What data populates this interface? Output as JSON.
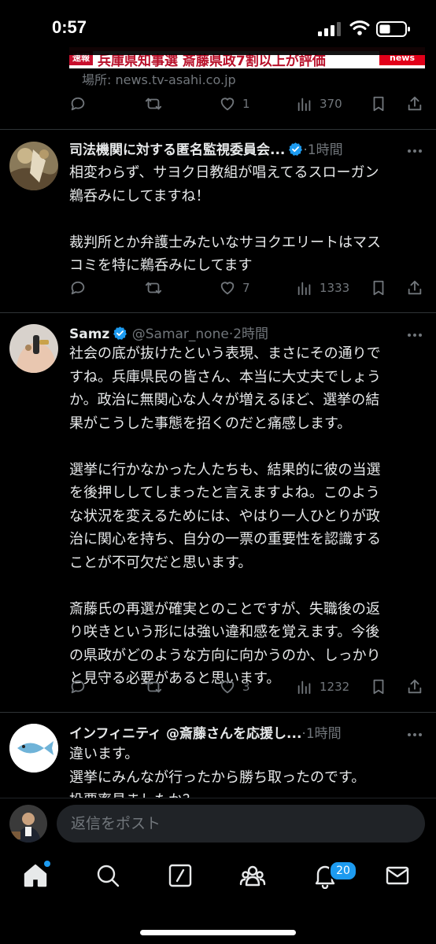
{
  "status": {
    "time": "0:57"
  },
  "quoted_card": {
    "banner_tag": "速報",
    "banner_text": "兵庫県知事選 斎藤県政7割以上が評価",
    "banner_logo": "news",
    "source": "場所: news.tv-asahi.co.jp"
  },
  "tweets": [
    {
      "actions": {
        "replies": "",
        "retweets": "",
        "likes": "1",
        "views": "370"
      }
    },
    {
      "name": "司法機関に対する匿名監視委員会...",
      "handle": "",
      "time": "·1時間",
      "text": "相変わらず、サヨク日教組が唱えてるスローガン\n鵜呑みにしてますね！\n\n裁判所とか弁護士みたいなサヨクエリートはマス\nコミを特に鵜呑みにしてます",
      "actions": {
        "replies": "",
        "retweets": "",
        "likes": "7",
        "views": "1333"
      }
    },
    {
      "name": "Samz",
      "handle": "@Samar_none",
      "time": "·2時間",
      "text": "社会の底が抜けたという表現、まさにその通りで\nすね。兵庫県民の皆さん、本当に大丈夫でしょう\nか。政治に無関心な人々が増えるほど、選挙の結\n果がこうした事態を招くのだと痛感します。\n\n選挙に行かなかった人たちも、結果的に彼の当選\nを後押ししてしまったと言えますよね。このよう\nな状況を変えるためには、やはり一人ひとりが政\n治に関心を持ち、自分の一票の重要性を認識する\nことが不可欠だと思います。\n\n斎藤氏の再選が確実とのことですが、失職後の返\nり咲きという形には強い違和感を覚えます。今後\nの県政がどのような方向に向かうのか、しっかり\nと見守る必要があると思います。",
      "actions": {
        "replies": "",
        "retweets": "",
        "likes": "3",
        "views": "1232"
      }
    },
    {
      "name": "インフィニティ @斎藤さんを応援し...",
      "handle": "",
      "time": "·1時間",
      "text": "違います。\n選挙にみんなが行ったから勝ち取ったのです。\n投票率見ましたか？"
    }
  ],
  "reply_bar": {
    "placeholder": "返信をポスト"
  },
  "tabbar": {
    "notification_count": "20"
  },
  "colors": {
    "accent": "#1d9bf0",
    "background": "#000000",
    "muted": "#71767b"
  }
}
